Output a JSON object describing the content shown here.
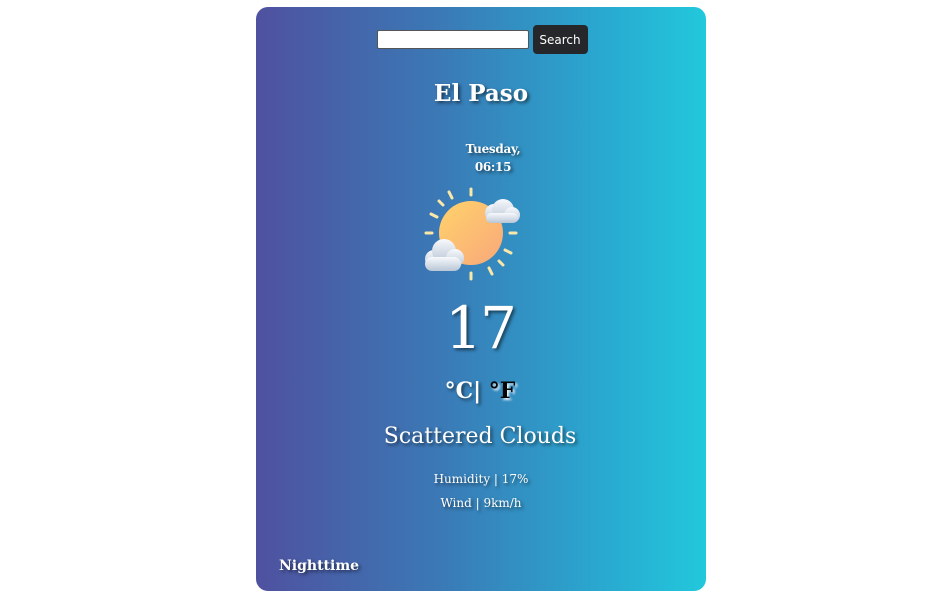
{
  "search": {
    "value": "",
    "placeholder": "",
    "button_label": "Search"
  },
  "weather": {
    "city": "El Paso",
    "day": "Tuesday,",
    "time": "06:15",
    "temperature": "17",
    "unit_c": "°C|",
    "unit_f": "°F",
    "description": "Scattered Clouds",
    "humidity": "Humidity | 17%",
    "wind": "Wind | 9km/h",
    "period": "Nighttime",
    "icon": "sun-behind-clouds-icon"
  },
  "colors": {
    "gradient_start": "#4f519f",
    "gradient_end": "#22c8dc",
    "button_bg": "#25272b",
    "text": "#ffffff"
  }
}
